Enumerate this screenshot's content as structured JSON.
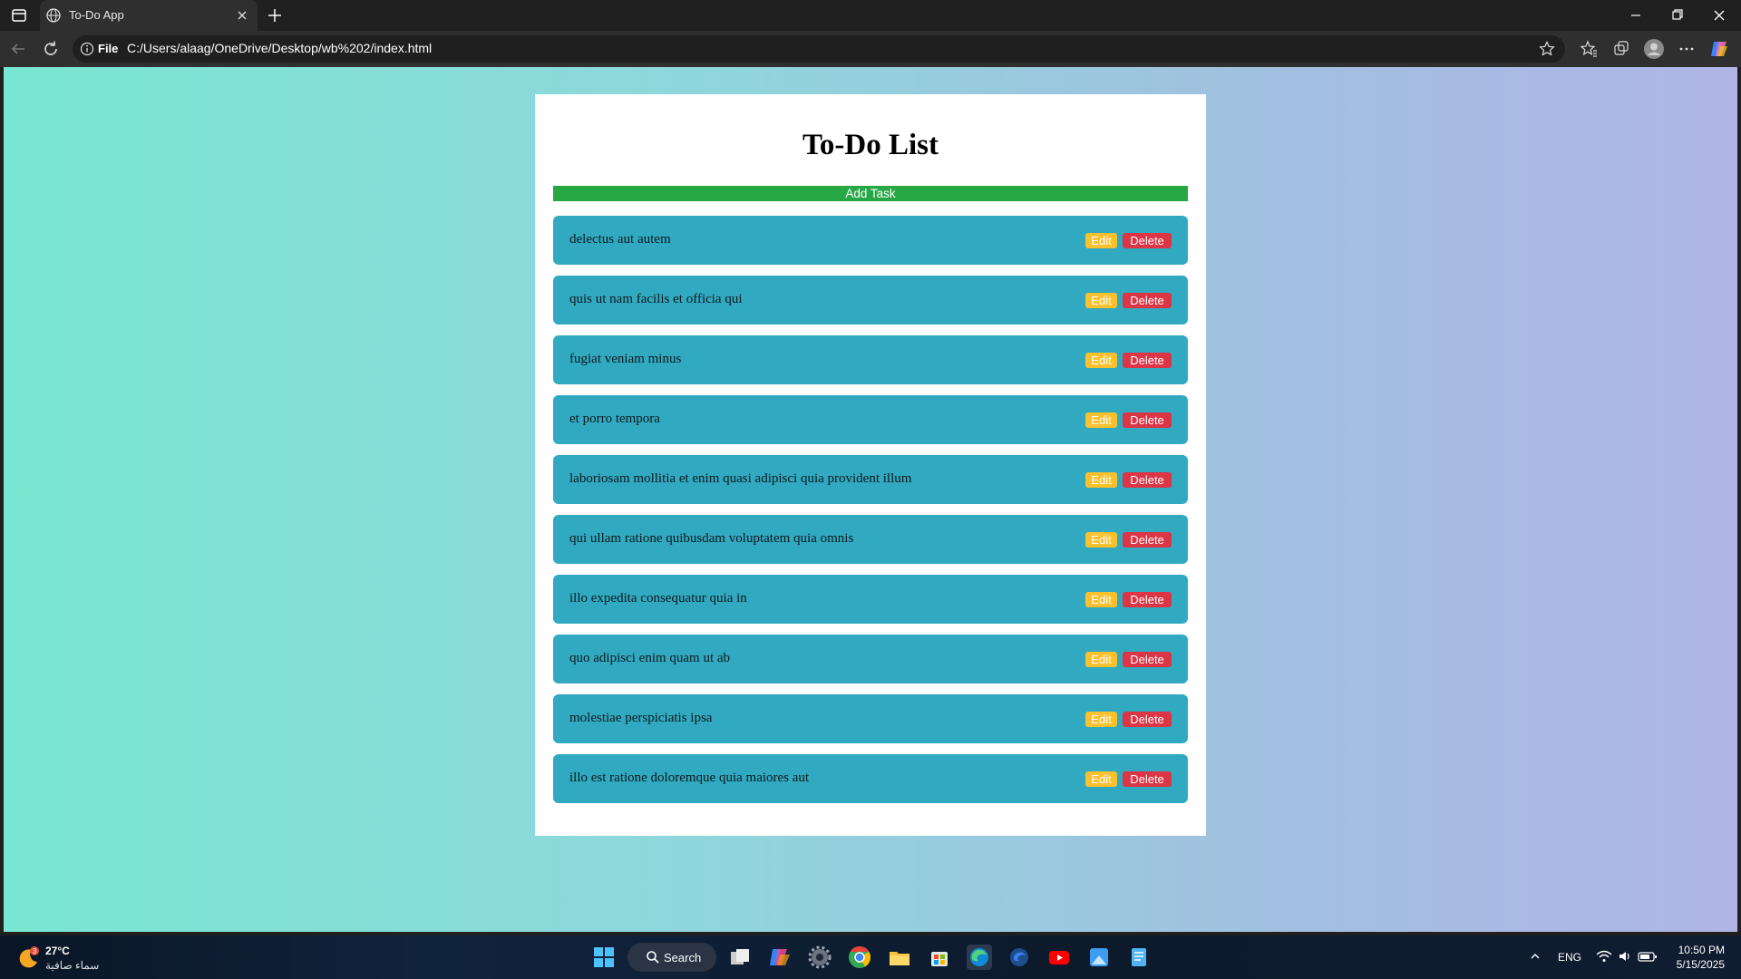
{
  "browser": {
    "tab_title": "To-Do App",
    "url_scheme": "File",
    "url": "C:/Users/alaag/OneDrive/Desktop/wb%202/index.html"
  },
  "app": {
    "title": "To-Do List",
    "add_button": "Add Task",
    "edit_label": "Edit",
    "delete_label": "Delete",
    "tasks": [
      "delectus aut autem",
      "quis ut nam facilis et officia qui",
      "fugiat veniam minus",
      "et porro tempora",
      "laboriosam mollitia et enim quasi adipisci quia provident illum",
      "qui ullam ratione quibusdam voluptatem quia omnis",
      "illo expedita consequatur quia in",
      "quo adipisci enim quam ut ab",
      "molestiae perspiciatis ipsa",
      "illo est ratione doloremque quia maiores aut"
    ],
    "colors": {
      "add_button": "#28a745",
      "task_bg": "#31a9c1",
      "edit_button": "#fbc02d",
      "delete_button": "#dc3545"
    }
  },
  "taskbar": {
    "weather_temp": "27°C",
    "weather_desc": "سماء صافية",
    "weather_badge": "3",
    "search_label": "Search",
    "language": "ENG",
    "time": "10:50 PM",
    "date": "5/15/2025"
  }
}
